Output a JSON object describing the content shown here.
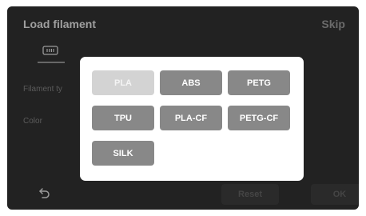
{
  "header": {
    "title": "Load filament",
    "skip_label": "Skip"
  },
  "tabs": [
    {
      "icon": "spool-icon",
      "active": true
    }
  ],
  "fields": {
    "filament_type_label": "Filament ty",
    "color_label": "Color"
  },
  "footer": {
    "back_icon": "back-arrow-icon",
    "reset_label": "Reset",
    "ok_label": "OK"
  },
  "dialog": {
    "selected": "PLA",
    "options": [
      "PLA",
      "ABS",
      "PETG",
      "TPU",
      "PLA-CF",
      "PETG-CF",
      "SILK"
    ]
  },
  "colors": {
    "screen_bg": "#2e2e2e",
    "option_bg": "#888888",
    "option_selected_bg": "#d3d3d3",
    "dialog_bg": "#ffffff"
  }
}
